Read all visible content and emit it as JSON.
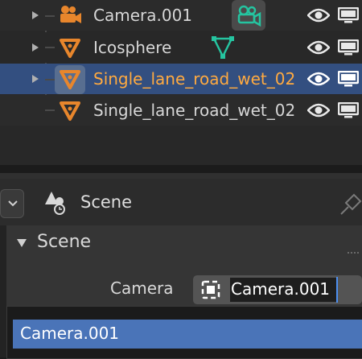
{
  "outliner": {
    "items": [
      {
        "name": "Camera.001",
        "type": "camera",
        "selected": false
      },
      {
        "name": "Icosphere",
        "type": "mesh",
        "selected": false
      },
      {
        "name": "Single_lane_road_wet_02",
        "type": "mesh",
        "selected": true,
        "active": true
      },
      {
        "name": "Single_lane_road_wet_02",
        "type": "mesh",
        "selected": false
      }
    ]
  },
  "properties": {
    "context_title": "Scene",
    "panel_title": "Scene",
    "camera_label": "Camera",
    "camera_value": "Camera.001",
    "dropdown_items": [
      "Camera.001"
    ]
  },
  "colors": {
    "accent_orange": "#e8862c",
    "selected_row": "#334f80",
    "selected_item": "#4a74b8",
    "data_icon_green": "#25c4a0",
    "active_text": "#ffaa40"
  },
  "icons": [
    "expand-triangle-icon",
    "camera-icon",
    "mesh-icon",
    "eye-icon",
    "monitor-icon",
    "camera-data-icon",
    "mesh-data-icon",
    "scene-icon",
    "pin-icon",
    "chevron-down-icon",
    "collapse-triangle-icon"
  ]
}
